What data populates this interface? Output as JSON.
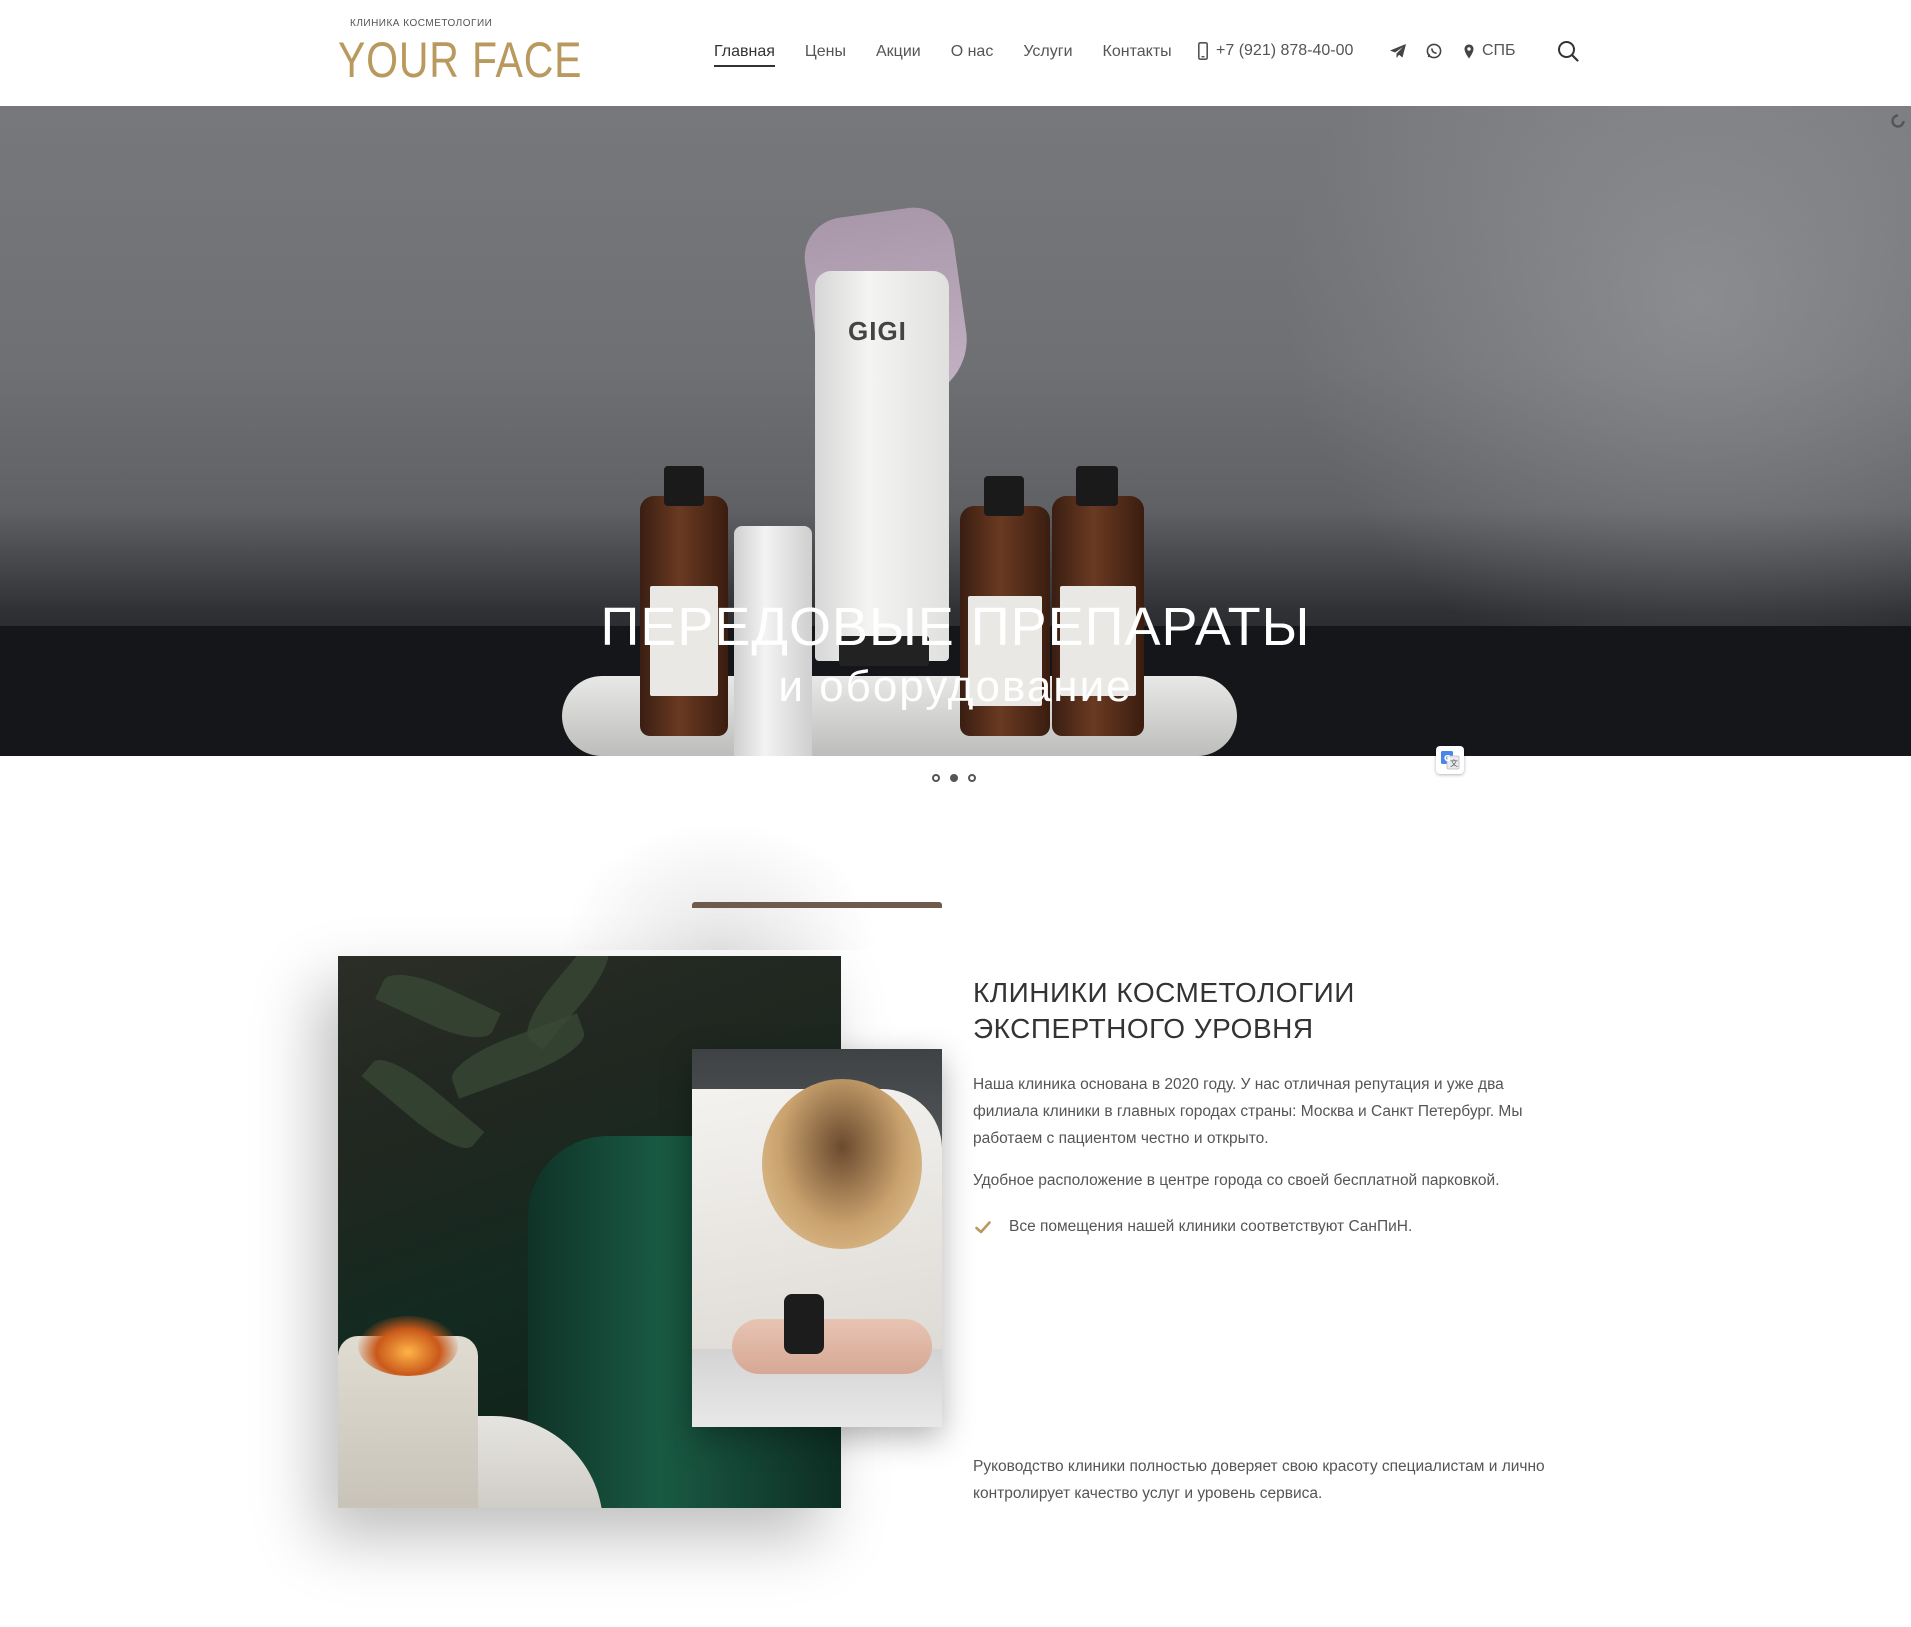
{
  "header": {
    "logo_sub": "КЛИНИКА КОСМЕТОЛОГИИ",
    "logo_main": "YOUR FACE",
    "nav": [
      {
        "label": "Главная",
        "active": true
      },
      {
        "label": "Цены"
      },
      {
        "label": "Акции"
      },
      {
        "label": "О нас"
      },
      {
        "label": "Услуги"
      },
      {
        "label": "Контакты"
      }
    ],
    "phone": "+7 (921) 878-40-00",
    "city": "СПБ",
    "icons": [
      "phone-icon",
      "telegram-icon",
      "whatsapp-icon",
      "location-icon",
      "search-icon"
    ],
    "logo_color": "#b9995e"
  },
  "hero": {
    "title": "ПЕРЕДОВЫЕ ПРЕПАРАТЫ",
    "subtitle": "и оборудование",
    "product_brand": "GIGI",
    "slides": 3,
    "active_slide": 2
  },
  "about": {
    "title": "КЛИНИКИ КОСМЕТОЛОГИИ ЭКСПЕРТНОГО УРОВНЯ",
    "paragraph1": "Наша клиника основана в 2020 году. У нас отличная репутация и уже два филиала клиники в главных городах страны: Москва и Санкт Петербург. Мы работаем с пациентом честно и открыто.",
    "paragraph2": "Удобное расположение в центре города со своей бесплатной парковкой.",
    "check_item": "Все помещения нашей клиники соответствуют СанПиН.",
    "paragraph3": "Руководство клиники полностью доверяет свою красоту специалистам и лично контролирует качество услуг и уровень сервиса.",
    "accent_color": "#b9995e"
  }
}
